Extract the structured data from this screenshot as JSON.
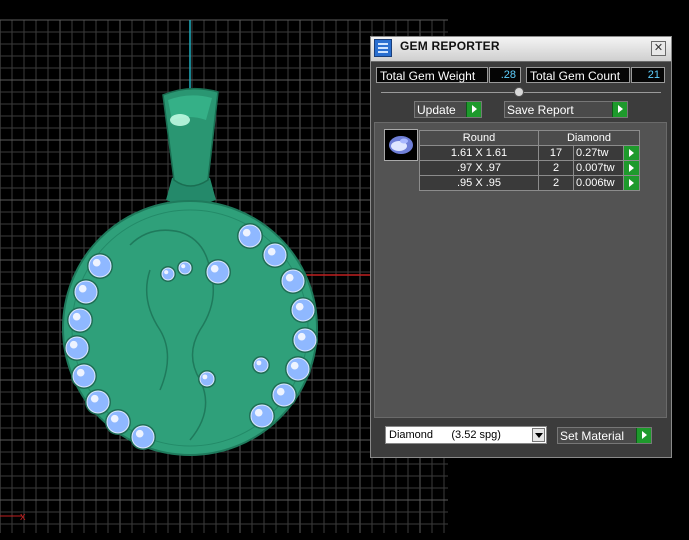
{
  "viewport": {
    "axis_label": "x",
    "colors": {
      "grid": "#3b3b3b",
      "grid_major": "#5a5a5a",
      "pendant": "#2fa07a",
      "pendant_dark": "#1f7a5c",
      "gem": "#8fb8ff",
      "axis_y": "#1fb0c0",
      "axis_x": "#c02020"
    }
  },
  "panel": {
    "title": "GEM REPORTER",
    "close_glyph": "✕",
    "total_weight_label": "Total Gem Weight",
    "total_weight_value": ".28",
    "total_count_label": "Total Gem Count",
    "total_count_value": "21",
    "update_label": "Update",
    "save_report_label": "Save Report",
    "table": {
      "shape_header": "Round",
      "material_header": "Diamond",
      "rows": [
        {
          "size": "1.61 X 1.61",
          "count": "17",
          "weight": "0.27tw"
        },
        {
          "size": ".97 X .97",
          "count": "2",
          "weight": "0.007tw"
        },
        {
          "size": ".95 X .95",
          "count": "2",
          "weight": "0.006tw"
        }
      ]
    },
    "material_select": "Diamond      (3.52 spg)",
    "set_material_label": "Set Material",
    "accent_color": "#1e9a2c"
  }
}
